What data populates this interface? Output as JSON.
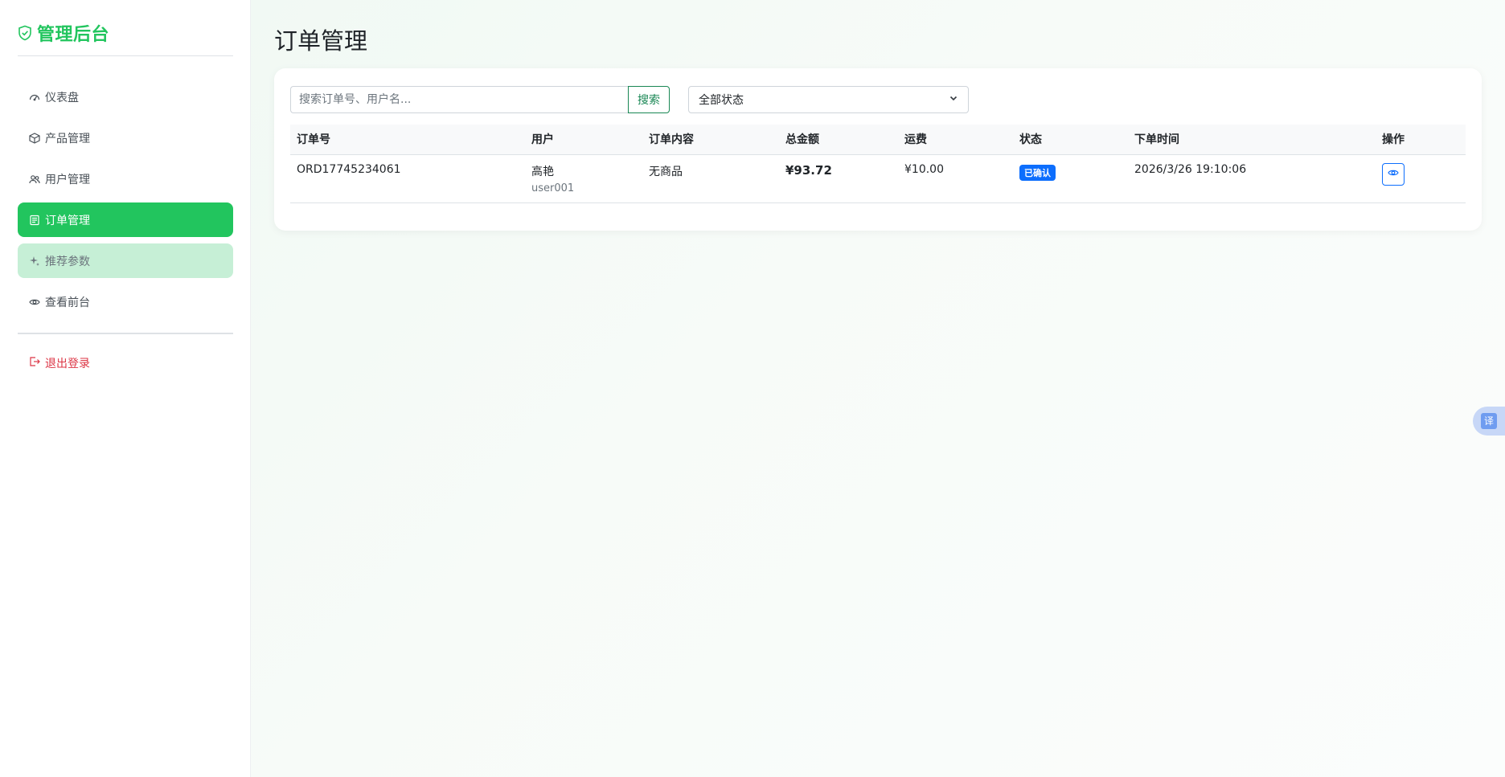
{
  "brand": {
    "title": "管理后台",
    "icon": "shield-check-icon",
    "color": "#22c55e"
  },
  "sidebar": {
    "items": [
      {
        "label": "仪表盘",
        "icon": "speedometer-icon"
      },
      {
        "label": "产品管理",
        "icon": "box-icon"
      },
      {
        "label": "用户管理",
        "icon": "people-icon"
      },
      {
        "label": "订单管理",
        "icon": "receipt-icon",
        "active": true
      },
      {
        "label": "推荐参数",
        "icon": "sparkle-icon"
      },
      {
        "label": "查看前台",
        "icon": "eye-icon"
      }
    ],
    "logout": {
      "label": "退出登录",
      "icon": "logout-icon"
    }
  },
  "page": {
    "title": "订单管理"
  },
  "filters": {
    "search_placeholder": "搜索订单号、用户名...",
    "search_button": "搜索",
    "status_value": "全部状态"
  },
  "table": {
    "columns": [
      "订单号",
      "用户",
      "订单内容",
      "总金额",
      "运费",
      "状态",
      "下单时间",
      "操作"
    ],
    "rows": [
      {
        "order_no": "ORD17745234061",
        "user_name": "高艳",
        "user_id": "user001",
        "content": "无商品",
        "total": "¥93.72",
        "shipping": "¥10.00",
        "status": "已确认",
        "time": "2026/3/26 19:10:06",
        "action_icon": "eye-icon"
      }
    ]
  },
  "translate_fab": {
    "label": "译"
  },
  "colors": {
    "accent": "#22c55e",
    "primary": "#0d6efd",
    "success": "#198754",
    "danger": "#dc3545"
  }
}
